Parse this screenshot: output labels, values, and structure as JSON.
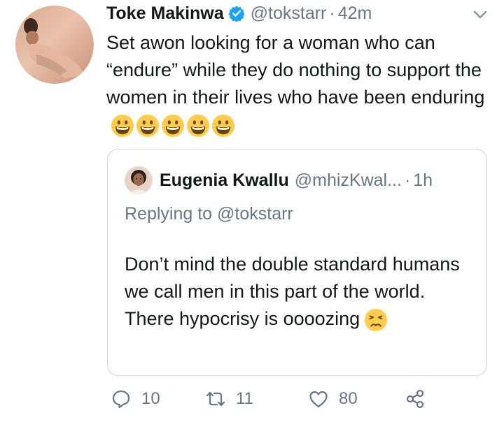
{
  "tweet": {
    "author_name": "Toke Makinwa",
    "handle": "@tokstarr",
    "separator": "·",
    "time": "42m",
    "text": "Set awon looking for a woman who can “endure” while they do nothing to support the women in their lives who have been enduring",
    "emoji_icon": "grinning-face-icon",
    "emoji_count": 5
  },
  "quoted_tweet": {
    "author_name": "Eugenia Kwallu",
    "handle": "@mhizKwal...",
    "separator": "·",
    "time": "1h",
    "replying_prefix": "Replying to",
    "replying_to": "@tokstarr",
    "text": "Don’t mind the double standard humans we call men in this part of the world. There hypocrisy is oooozing",
    "emoji_icon": "persevering-face-icon"
  },
  "actions": {
    "reply_count": "10",
    "retweet_count": "11",
    "like_count": "80"
  },
  "colors": {
    "text": "#14171a",
    "secondary": "#657786",
    "verified": "#1da1f2",
    "border": "#ccd6dd"
  }
}
